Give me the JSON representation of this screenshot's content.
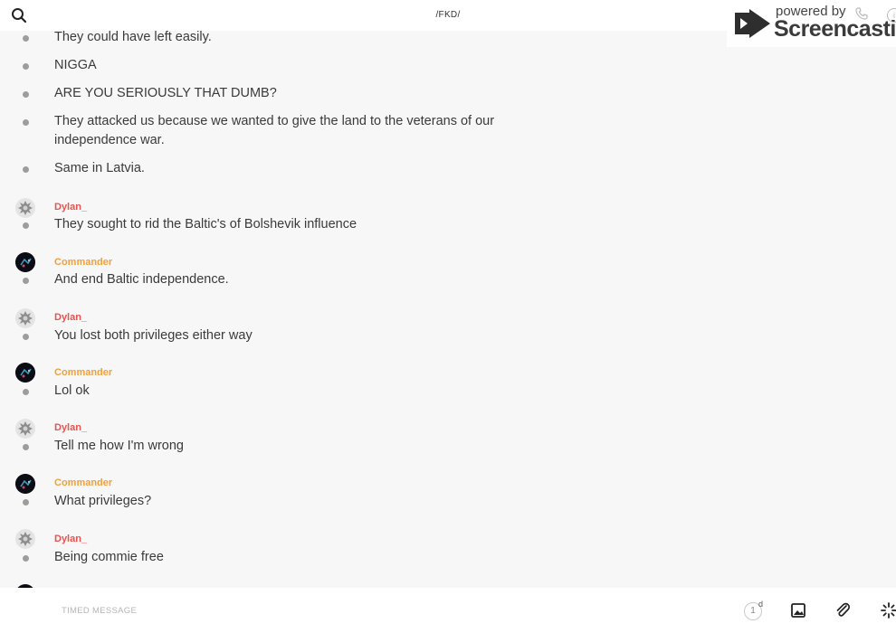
{
  "header": {
    "channel": "/FKD/"
  },
  "watermark": {
    "top": "powered by",
    "bottom": "Screencastify"
  },
  "messages": [
    {
      "text": "They could have left easily."
    },
    {
      "text": "NIGGA"
    },
    {
      "text": "ARE YOU SERIOUSLY THAT DUMB?"
    },
    {
      "text": "They attacked us because we wanted to give the land to the veterans of our independence war."
    },
    {
      "text": "Same in Latvia."
    },
    {
      "author": "Dylan_",
      "text": "They sought to rid the Baltic's of Bolshevik influence"
    },
    {
      "author": "Commander",
      "text": "And end Baltic independence."
    },
    {
      "author": "Dylan_",
      "text": "You lost both privileges either way"
    },
    {
      "author": "Commander",
      "text": "Lol ok"
    },
    {
      "author": "Dylan_",
      "text": "Tell me how I'm wrong"
    },
    {
      "author": "Commander",
      "text": "What privileges?"
    },
    {
      "author": "Dylan_",
      "text": "Being commie  free"
    }
  ],
  "composer": {
    "placeholder": "TIMED MESSAGE",
    "timer_value": "1",
    "timer_unit": "d"
  },
  "colors": {
    "dylan": "#e8534f",
    "commander": "#f2a03a",
    "bullet": "#9d9d9d"
  },
  "icons": [
    "search-icon",
    "image-icon",
    "paperclip-icon",
    "sparkle-icon"
  ]
}
